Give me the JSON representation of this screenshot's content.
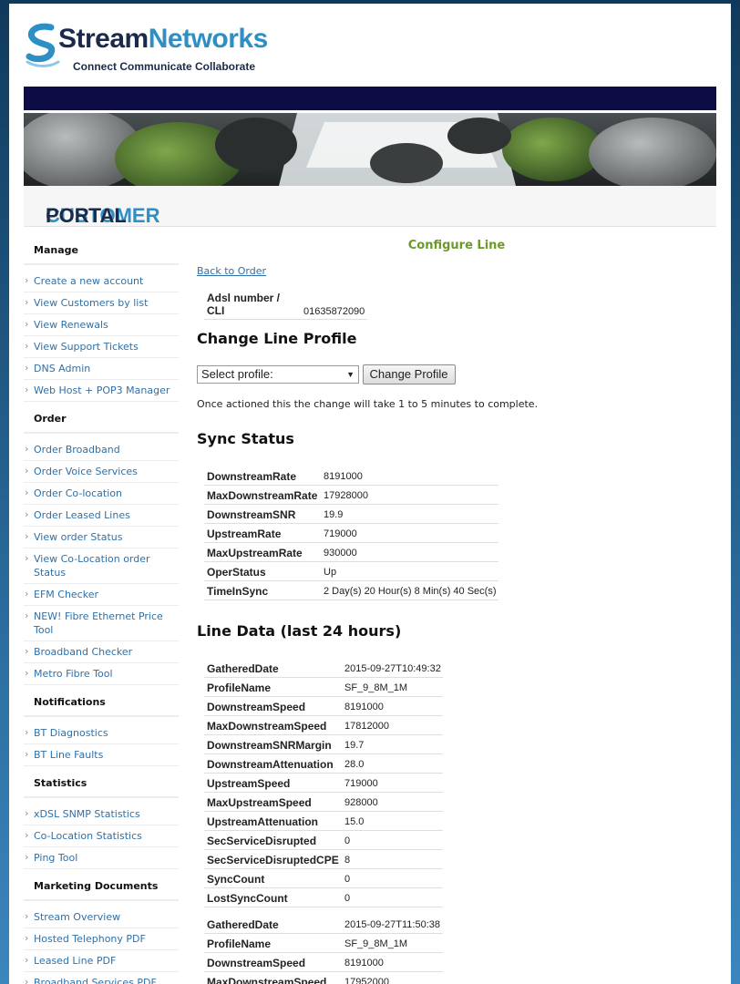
{
  "brand": {
    "name_part1": "tream",
    "name_part2": "Networks",
    "tagline": "Connect Communicate Collaborate",
    "colors": {
      "dark": "#1b2a4a",
      "accent": "#2e8fc4",
      "nav": "#0d0c45"
    }
  },
  "portal": {
    "title_part1": "CUSTOMER",
    "title_part2": "PORTAL"
  },
  "sidebar": [
    {
      "heading": "Manage",
      "items": [
        "Create a new account",
        "View Customers by list",
        "View Renewals",
        "View Support Tickets",
        "DNS Admin",
        "Web Host + POP3 Manager"
      ]
    },
    {
      "heading": "Order",
      "items": [
        "Order Broadband",
        "Order Voice Services",
        "Order Co-location",
        "Order Leased Lines",
        "View order Status",
        "View Co-Location order Status",
        "EFM Checker",
        "NEW! Fibre Ethernet Price Tool",
        "Broadband Checker",
        "Metro Fibre Tool"
      ]
    },
    {
      "heading": "Notifications",
      "items": [
        "BT Diagnostics",
        "BT Line Faults"
      ]
    },
    {
      "heading": "Statistics",
      "items": [
        "xDSL SNMP Statistics",
        "Co-Location Statistics",
        "Ping Tool"
      ]
    },
    {
      "heading": "Marketing Documents",
      "items": [
        "Stream Overview",
        "Hosted Telephony PDF",
        "Leased Line PDF",
        "Broadband Services PDF"
      ]
    }
  ],
  "main": {
    "title": "Configure Line",
    "back_link": "Back to Order",
    "cli_label": "Adsl number / CLI",
    "cli_value": "01635872090",
    "change_profile_heading": "Change Line Profile",
    "select_value": "Select profile:",
    "change_button": "Change Profile",
    "note": "Once actioned this the change will take 1 to 5 minutes to complete.",
    "sync_heading": "Sync Status",
    "sync_rows": [
      [
        "DownstreamRate",
        "8191000"
      ],
      [
        "MaxDownstreamRate",
        "17928000"
      ],
      [
        "DownstreamSNR",
        "19.9"
      ],
      [
        "UpstreamRate",
        "719000"
      ],
      [
        "MaxUpstreamRate",
        "930000"
      ],
      [
        "OperStatus",
        "Up"
      ],
      [
        "TimeInSync",
        "2 Day(s) 20 Hour(s) 8 Min(s) 40 Sec(s)"
      ]
    ],
    "line_heading": "Line Data (last 24 hours)",
    "line_records": [
      [
        [
          "GatheredDate",
          "2015-09-27T10:49:32"
        ],
        [
          "ProfileName",
          "SF_9_8M_1M"
        ],
        [
          "DownstreamSpeed",
          "8191000"
        ],
        [
          "MaxDownstreamSpeed",
          "17812000"
        ],
        [
          "DownstreamSNRMargin",
          "19.7"
        ],
        [
          "DownstreamAttenuation",
          "28.0"
        ],
        [
          "UpstreamSpeed",
          "719000"
        ],
        [
          "MaxUpstreamSpeed",
          "928000"
        ],
        [
          "UpstreamAttenuation",
          "15.0"
        ],
        [
          "SecServiceDisrupted",
          "0"
        ],
        [
          "SecServiceDisruptedCPE",
          "8"
        ],
        [
          "SyncCount",
          "0"
        ],
        [
          "LostSyncCount",
          "0"
        ]
      ],
      [
        [
          "GatheredDate",
          "2015-09-27T11:50:38"
        ],
        [
          "ProfileName",
          "SF_9_8M_1M"
        ],
        [
          "DownstreamSpeed",
          "8191000"
        ],
        [
          "MaxDownstreamSpeed",
          "17952000"
        ]
      ]
    ]
  }
}
